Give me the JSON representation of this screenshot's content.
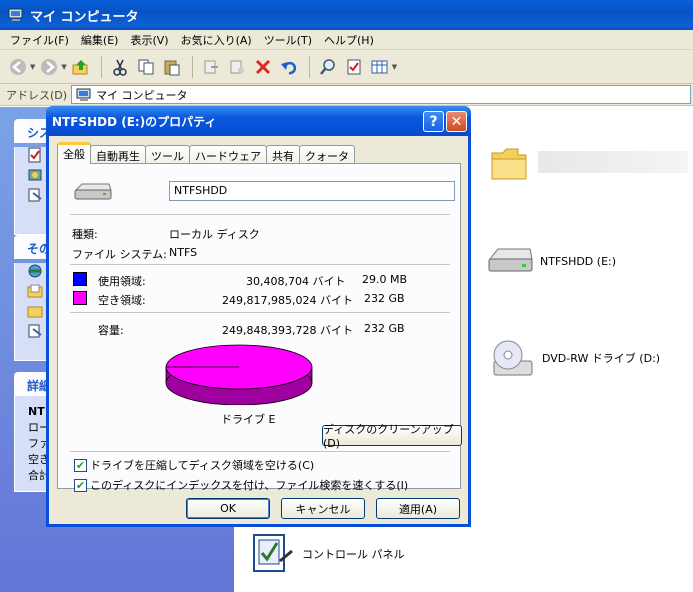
{
  "window": {
    "title": "マイ コンピュータ",
    "menu": [
      "ファイル(F)",
      "編集(E)",
      "表示(V)",
      "お気に入り(A)",
      "ツール(T)",
      "ヘルプ(H)"
    ],
    "address_label": "アドレス(D)",
    "address_value": "マイ コンピュータ"
  },
  "taskpane": {
    "box1_title": "シス",
    "box2_title": "その",
    "box3_title": "詳細",
    "details": [
      "NT",
      "ロー",
      "ファ",
      "空き",
      "合計"
    ]
  },
  "content": {
    "items": [
      {
        "label": "NTFSHDD (E:)",
        "icon": "hard-drive-icon"
      },
      {
        "label": "DVD-RW ドライブ (D:)",
        "icon": "dvd-drive-icon"
      },
      {
        "label": "コントロール パネル",
        "icon": "control-panel-icon"
      }
    ]
  },
  "dialog": {
    "title": "NTFSHDD (E:)のプロパティ",
    "tabs": [
      "全般",
      "自動再生",
      "ツール",
      "ハードウェア",
      "共有",
      "クォータ"
    ],
    "active_tab": "全般",
    "volume_name": "NTFSHDD",
    "type_label": "種類:",
    "type_value": "ローカル ディスク",
    "fs_label": "ファイル システム:",
    "fs_value": "NTFS",
    "used_label": "使用領域:",
    "used_bytes": "30,408,704 バイト",
    "used_size": "29.0 MB",
    "free_label": "空き領域:",
    "free_bytes": "249,817,985,024 バイト",
    "free_size": "232 GB",
    "capacity_label": "容量:",
    "capacity_bytes": "249,848,393,728 バイト",
    "capacity_size": "232 GB",
    "drive_caption": "ドライブ E",
    "cleanup_button": "ディスクのクリーンアップ(D)",
    "compress_label": "ドライブを圧縮してディスク領域を空ける(C)",
    "compress_checked": true,
    "index_label": "このディスクにインデックスを付け、ファイル検索を速くする(I)",
    "index_checked": true,
    "ok_button": "OK",
    "cancel_button": "キャンセル",
    "apply_button": "適用(A)",
    "colors": {
      "used": "#0000ff",
      "free": "#ff00ff",
      "free_dark": "#a000a0"
    }
  }
}
